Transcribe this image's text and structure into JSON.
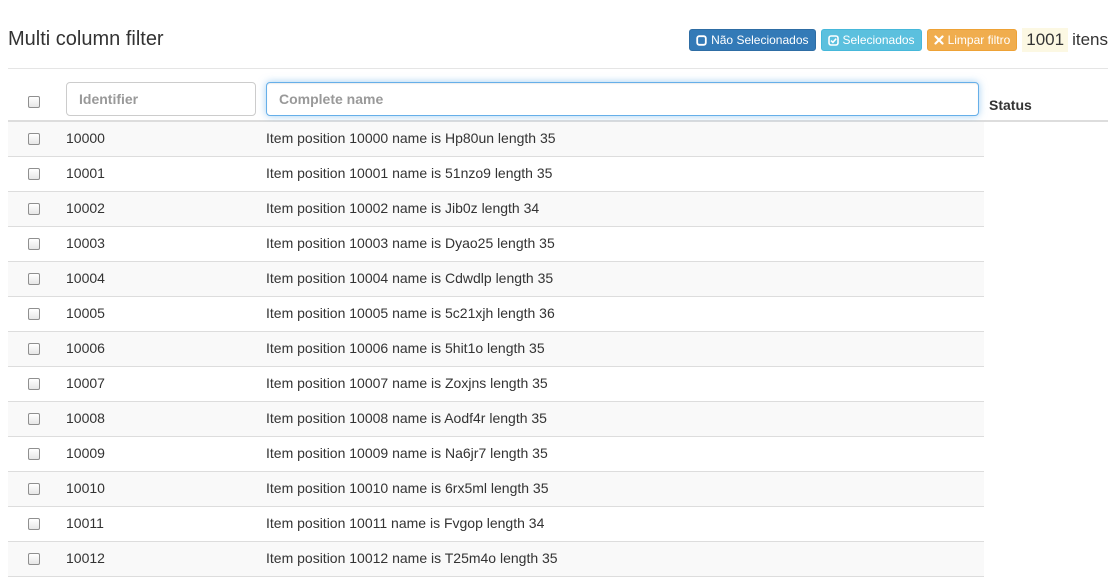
{
  "page": {
    "title": "Multi column filter"
  },
  "toolbar": {
    "btn_not_selected": "Não Selecionados",
    "btn_selected": "Selecionados",
    "btn_clear": "Limpar filtro",
    "count": "1001",
    "count_suffix": "itens",
    "colors": {
      "primary": "#337ab7",
      "info": "#5bc0de",
      "warning": "#f0ad4e",
      "badge_bg": "#fcf8e3"
    }
  },
  "table": {
    "filters": {
      "identifier_placeholder": "Identifier",
      "identifier_value": "",
      "name_placeholder": "Complete name",
      "name_value": ""
    },
    "status_header": "Status",
    "rows": [
      {
        "id": "10000",
        "name": "Item position 10000 name is Hp80un length 35"
      },
      {
        "id": "10001",
        "name": "Item position 10001 name is 51nzo9 length 35"
      },
      {
        "id": "10002",
        "name": "Item position 10002 name is Jib0z length 34"
      },
      {
        "id": "10003",
        "name": "Item position 10003 name is Dyao25 length 35"
      },
      {
        "id": "10004",
        "name": "Item position 10004 name is Cdwdlp length 35"
      },
      {
        "id": "10005",
        "name": "Item position 10005 name is 5c21xjh length 36"
      },
      {
        "id": "10006",
        "name": "Item position 10006 name is 5hit1o length 35"
      },
      {
        "id": "10007",
        "name": "Item position 10007 name is Zoxjns length 35"
      },
      {
        "id": "10008",
        "name": "Item position 10008 name is Aodf4r length 35"
      },
      {
        "id": "10009",
        "name": "Item position 10009 name is Na6jr7 length 35"
      },
      {
        "id": "10010",
        "name": "Item position 10010 name is 6rx5ml length 35"
      },
      {
        "id": "10011",
        "name": "Item position 10011 name is Fvgop length 34"
      },
      {
        "id": "10012",
        "name": "Item position 10012 name is T25m4o length 35"
      }
    ]
  }
}
